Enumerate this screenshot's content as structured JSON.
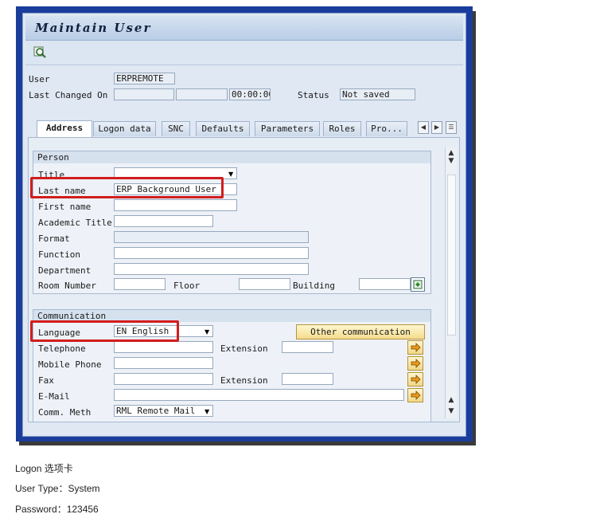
{
  "window": {
    "title": "Maintain User"
  },
  "header": {
    "user_label": "User",
    "user_value": "ERPREMOTE",
    "last_changed_label": "Last Changed On",
    "time_value": "00:00:00",
    "status_label": "Status",
    "status_value": "Not saved"
  },
  "tabs": [
    {
      "label": "Address",
      "active": true
    },
    {
      "label": "Logon data"
    },
    {
      "label": "SNC"
    },
    {
      "label": "Defaults"
    },
    {
      "label": "Parameters"
    },
    {
      "label": "Roles"
    },
    {
      "label": "Pro..."
    }
  ],
  "person": {
    "title": "Person",
    "title_label": "Title",
    "title_value": "",
    "last_name_label": "Last name",
    "last_name_value": "ERP Background User",
    "first_name_label": "First name",
    "academic_title_label": "Academic Title",
    "format_label": "Format",
    "function_label": "Function",
    "department_label": "Department",
    "room_label": "Room Number",
    "floor_label": "Floor",
    "building_label": "Building"
  },
  "communication": {
    "title": "Communication",
    "language_label": "Language",
    "language_value": "EN English",
    "other_button": "Other communication",
    "telephone_label": "Telephone",
    "extension_label": "Extension",
    "mobile_label": "Mobile Phone",
    "fax_label": "Fax",
    "fax_extension_label": "Extension",
    "email_label": "E-Mail",
    "comm_method_label": "Comm. Meth",
    "comm_method_value": "RML Remote Mail"
  },
  "captions": {
    "logon_tab": "Logon 选项卡",
    "user_type": "User Type：System",
    "password": "Password：123456"
  },
  "colors": {
    "frame": "#1a3d9c",
    "highlight": "#d11d1d",
    "button": "#f1d887"
  }
}
